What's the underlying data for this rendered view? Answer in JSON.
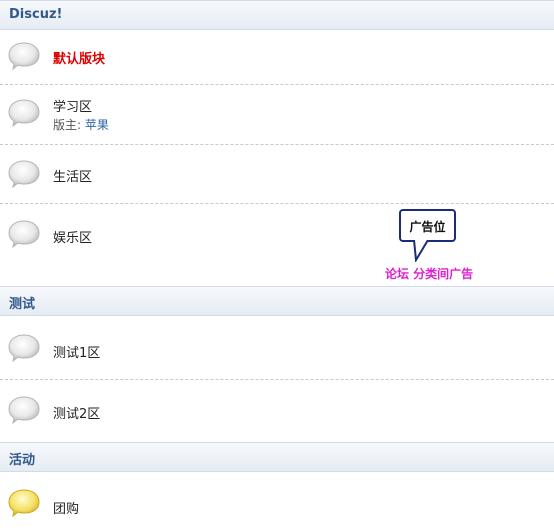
{
  "categories": [
    {
      "title": "Discuz!"
    },
    {
      "title": "测试"
    },
    {
      "title": "活动"
    }
  ],
  "forums": {
    "default_board": {
      "name": "默认版块"
    },
    "study": {
      "name": "学习区",
      "moderator_label": "版主:",
      "moderator": "苹果"
    },
    "life": {
      "name": "生活区"
    },
    "entertainment": {
      "name": "娱乐区"
    },
    "test1": {
      "name": "测试1区"
    },
    "test2": {
      "name": "测试2区"
    },
    "group_buy": {
      "name": "团购"
    }
  },
  "ad": {
    "callout": "广告位",
    "caption": "论坛 分类间广告"
  },
  "colors": {
    "category_title": "#32598a",
    "highlight_forum": "#e00000",
    "ad_border": "#1c2c7a",
    "ad_caption": "#e020d0",
    "bubble_new": "#f3d84a"
  },
  "icons": {
    "forum_icon": "speech-bubble-icon",
    "new_forum_icon": "speech-bubble-new-icon"
  }
}
